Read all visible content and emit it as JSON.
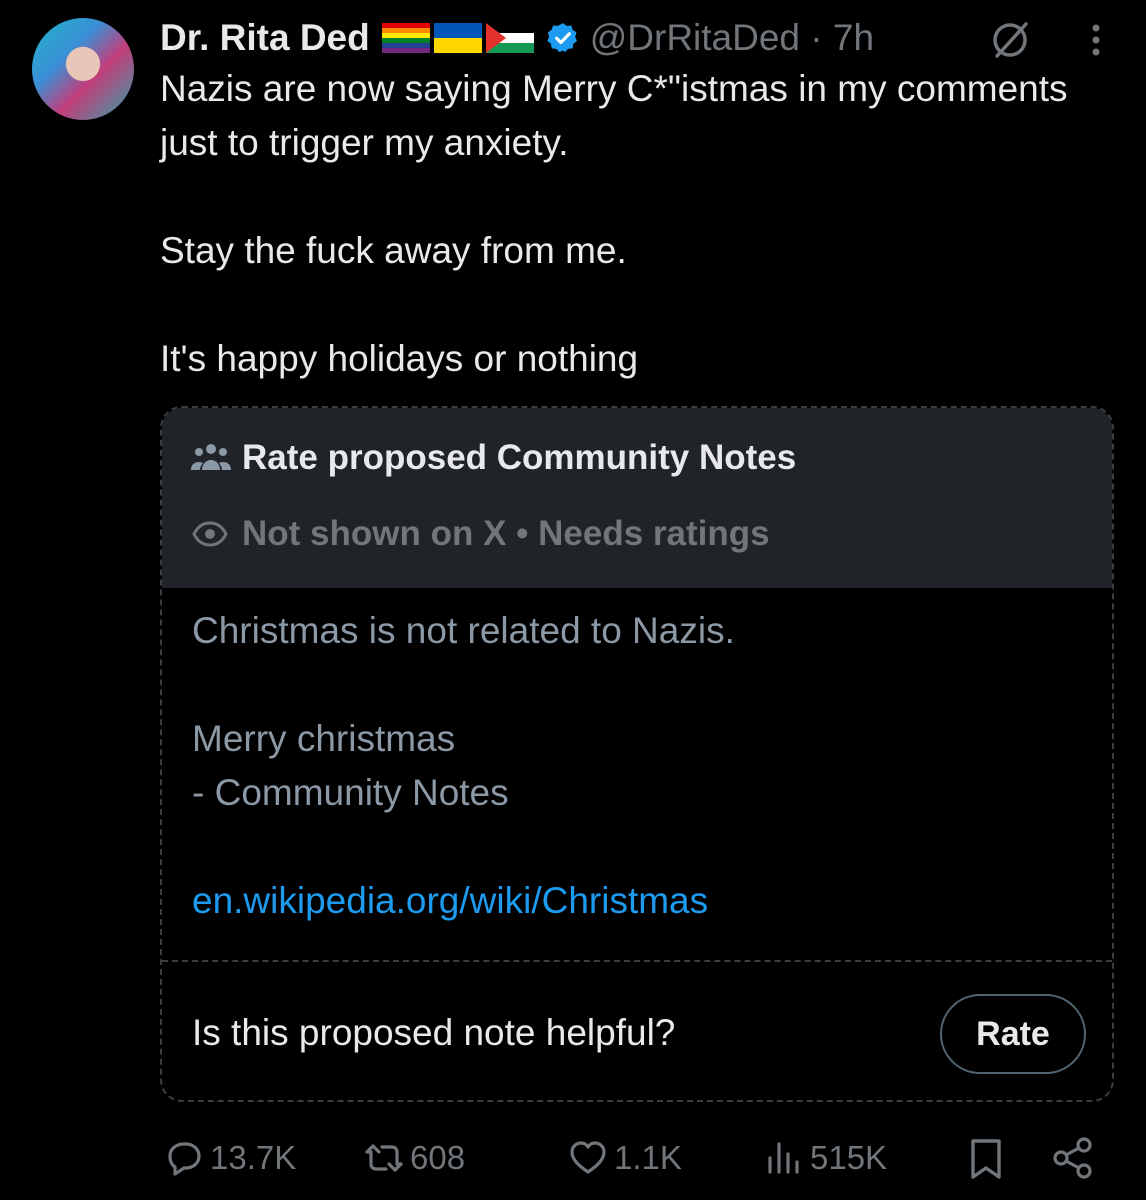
{
  "author": {
    "name": "Dr. Rita Ded",
    "handle_time": "@DrRitaDed · 7h",
    "flags": [
      "rainbow-flag",
      "ukraine-flag",
      "palestine-flag"
    ],
    "verified": true
  },
  "tweet": {
    "lines": [
      "Nazis are now saying Merry C*\"istmas in my comments just to trigger my anxiety.",
      "Stay the fuck away from me.",
      "It's happy holidays or nothing"
    ]
  },
  "community_note": {
    "title": "Rate proposed Community Notes",
    "status": "Not shown on X • Needs ratings",
    "body_line1": "Christmas is not related to Nazis.",
    "body_line2": "Merry christmas",
    "body_line3": "- Community Notes",
    "link": "en.wikipedia.org/wiki/Christmas",
    "question": "Is this proposed note helpful?",
    "rate_label": "Rate"
  },
  "actions": {
    "replies": "13.7K",
    "reposts": "608",
    "likes": "1.1K",
    "views": "515K"
  },
  "colors": {
    "background": "#000000",
    "text": "#e7e9ea",
    "muted": "#71767b",
    "link": "#1d9bf0",
    "verified": "#1d9bf0",
    "note_header_bg": "#202327"
  },
  "icons": [
    "grok-icon",
    "more-icon",
    "people-icon",
    "eye-icon",
    "reply-icon",
    "repost-icon",
    "like-icon",
    "views-icon",
    "bookmark-icon",
    "share-icon",
    "verified-badge-icon"
  ]
}
